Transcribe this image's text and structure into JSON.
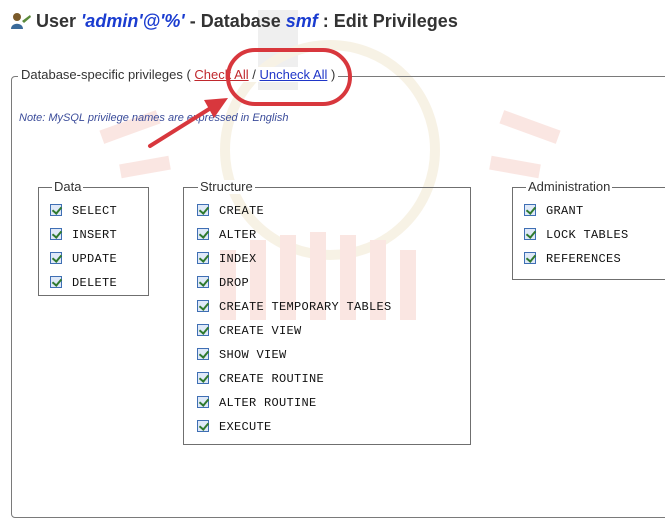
{
  "page": {
    "title_prefix": "User ",
    "user": "'admin'@'%'",
    "title_mid": " - Database ",
    "database": "smf",
    "title_suffix": " : Edit Privileges"
  },
  "fieldset": {
    "legend": "Database-specific privileges",
    "open_paren": " ( ",
    "check_all": "Check All",
    "slash": " / ",
    "uncheck_all": "Uncheck All",
    "close_paren": " )",
    "note": "Note: MySQL privilege names are expressed in English"
  },
  "groups": {
    "data": {
      "legend": "Data",
      "items": [
        {
          "label": "SELECT",
          "checked": true
        },
        {
          "label": "INSERT",
          "checked": true
        },
        {
          "label": "UPDATE",
          "checked": true
        },
        {
          "label": "DELETE",
          "checked": true
        }
      ]
    },
    "structure": {
      "legend": "Structure",
      "items": [
        {
          "label": "CREATE",
          "checked": true
        },
        {
          "label": "ALTER",
          "checked": true
        },
        {
          "label": "INDEX",
          "checked": true
        },
        {
          "label": "DROP",
          "checked": true
        },
        {
          "label": "CREATE TEMPORARY TABLES",
          "checked": true
        },
        {
          "label": "CREATE VIEW",
          "checked": true
        },
        {
          "label": "SHOW VIEW",
          "checked": true
        },
        {
          "label": "CREATE ROUTINE",
          "checked": true
        },
        {
          "label": "ALTER ROUTINE",
          "checked": true
        },
        {
          "label": "EXECUTE",
          "checked": true
        }
      ]
    },
    "administration": {
      "legend": "Administration",
      "items": [
        {
          "label": "GRANT",
          "checked": true
        },
        {
          "label": "LOCK TABLES",
          "checked": true
        },
        {
          "label": "REFERENCES",
          "checked": true
        }
      ]
    }
  },
  "colors": {
    "link_blue": "#1f36c8",
    "annotation_red": "#d8373d"
  }
}
